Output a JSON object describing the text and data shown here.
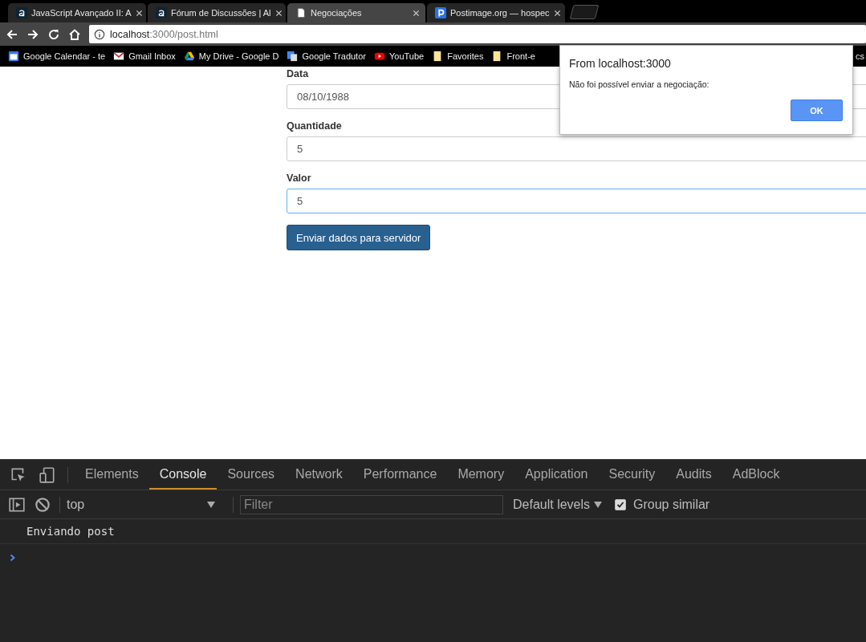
{
  "browser": {
    "tabs": [
      {
        "title": "JavaScript Avançado II: A",
        "kind": "a",
        "selected": false
      },
      {
        "title": "Fórum de Discussões | Al",
        "kind": "a",
        "selected": false
      },
      {
        "title": "Negociações",
        "kind": "doc",
        "selected": true
      },
      {
        "title": "Postimage.org — hospec",
        "kind": "p",
        "selected": false
      }
    ],
    "address": {
      "host": "localhost",
      "rest": ":3000/post.html"
    },
    "bookmarks": [
      {
        "label": "Google Calendar - te",
        "kind": "calendar"
      },
      {
        "label": "Gmail Inbox",
        "kind": "mail"
      },
      {
        "label": "My Drive - Google D",
        "kind": "drive"
      },
      {
        "label": "Google Tradutor",
        "kind": "translate"
      },
      {
        "label": "YouTube",
        "kind": "play"
      },
      {
        "label": "Favorites",
        "kind": "folder"
      },
      {
        "label": "Front-e",
        "kind": "folder"
      }
    ],
    "bookmark_edge": "cs"
  },
  "form": {
    "fields": [
      {
        "label": "Data",
        "value": "08/10/1988",
        "focused": false
      },
      {
        "label": "Quantidade",
        "value": "5",
        "focused": false
      },
      {
        "label": "Valor",
        "value": "5",
        "focused": true
      }
    ],
    "submit": "Enviar dados para servidor"
  },
  "dialog": {
    "title": "From localhost:3000",
    "message": "Não foi possível enviar a negociação:",
    "button": "OK"
  },
  "devtools": {
    "tabs": [
      {
        "label": "Elements",
        "selected": false
      },
      {
        "label": "Console",
        "selected": true
      },
      {
        "label": "Sources",
        "selected": false
      },
      {
        "label": "Network",
        "selected": false
      },
      {
        "label": "Performance",
        "selected": false
      },
      {
        "label": "Memory",
        "selected": false
      },
      {
        "label": "Application",
        "selected": false
      },
      {
        "label": "Security",
        "selected": false
      },
      {
        "label": "Audits",
        "selected": false
      },
      {
        "label": "AdBlock",
        "selected": false
      }
    ],
    "context": "top",
    "filter_placeholder": "Filter",
    "levels": "Default levels",
    "group_similar": {
      "label": "Group similar",
      "checked": true
    },
    "messages": [
      "Enviando post"
    ]
  }
}
